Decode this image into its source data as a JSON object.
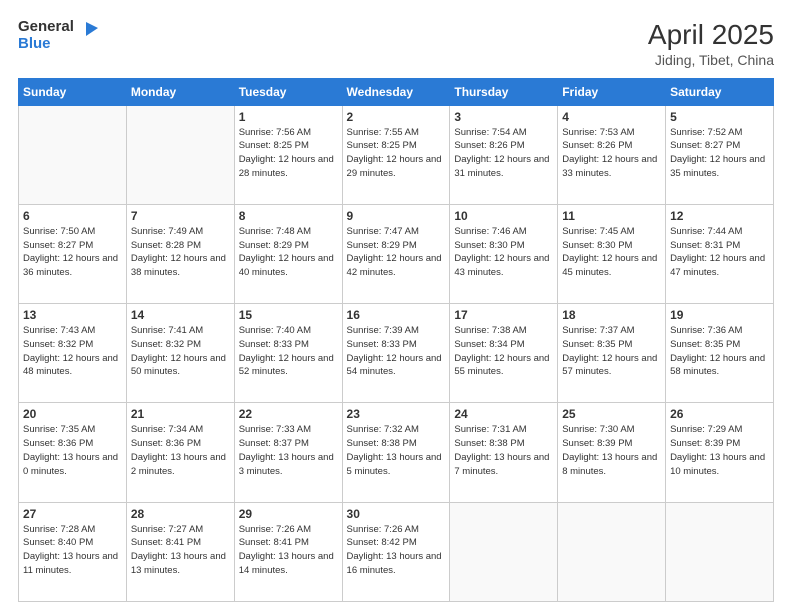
{
  "logo": {
    "general": "General",
    "blue": "Blue"
  },
  "title": "April 2025",
  "subtitle": "Jiding, Tibet, China",
  "days_header": [
    "Sunday",
    "Monday",
    "Tuesday",
    "Wednesday",
    "Thursday",
    "Friday",
    "Saturday"
  ],
  "weeks": [
    [
      {
        "day": "",
        "info": ""
      },
      {
        "day": "",
        "info": ""
      },
      {
        "day": "1",
        "info": "Sunrise: 7:56 AM\nSunset: 8:25 PM\nDaylight: 12 hours and 28 minutes."
      },
      {
        "day": "2",
        "info": "Sunrise: 7:55 AM\nSunset: 8:25 PM\nDaylight: 12 hours and 29 minutes."
      },
      {
        "day": "3",
        "info": "Sunrise: 7:54 AM\nSunset: 8:26 PM\nDaylight: 12 hours and 31 minutes."
      },
      {
        "day": "4",
        "info": "Sunrise: 7:53 AM\nSunset: 8:26 PM\nDaylight: 12 hours and 33 minutes."
      },
      {
        "day": "5",
        "info": "Sunrise: 7:52 AM\nSunset: 8:27 PM\nDaylight: 12 hours and 35 minutes."
      }
    ],
    [
      {
        "day": "6",
        "info": "Sunrise: 7:50 AM\nSunset: 8:27 PM\nDaylight: 12 hours and 36 minutes."
      },
      {
        "day": "7",
        "info": "Sunrise: 7:49 AM\nSunset: 8:28 PM\nDaylight: 12 hours and 38 minutes."
      },
      {
        "day": "8",
        "info": "Sunrise: 7:48 AM\nSunset: 8:29 PM\nDaylight: 12 hours and 40 minutes."
      },
      {
        "day": "9",
        "info": "Sunrise: 7:47 AM\nSunset: 8:29 PM\nDaylight: 12 hours and 42 minutes."
      },
      {
        "day": "10",
        "info": "Sunrise: 7:46 AM\nSunset: 8:30 PM\nDaylight: 12 hours and 43 minutes."
      },
      {
        "day": "11",
        "info": "Sunrise: 7:45 AM\nSunset: 8:30 PM\nDaylight: 12 hours and 45 minutes."
      },
      {
        "day": "12",
        "info": "Sunrise: 7:44 AM\nSunset: 8:31 PM\nDaylight: 12 hours and 47 minutes."
      }
    ],
    [
      {
        "day": "13",
        "info": "Sunrise: 7:43 AM\nSunset: 8:32 PM\nDaylight: 12 hours and 48 minutes."
      },
      {
        "day": "14",
        "info": "Sunrise: 7:41 AM\nSunset: 8:32 PM\nDaylight: 12 hours and 50 minutes."
      },
      {
        "day": "15",
        "info": "Sunrise: 7:40 AM\nSunset: 8:33 PM\nDaylight: 12 hours and 52 minutes."
      },
      {
        "day": "16",
        "info": "Sunrise: 7:39 AM\nSunset: 8:33 PM\nDaylight: 12 hours and 54 minutes."
      },
      {
        "day": "17",
        "info": "Sunrise: 7:38 AM\nSunset: 8:34 PM\nDaylight: 12 hours and 55 minutes."
      },
      {
        "day": "18",
        "info": "Sunrise: 7:37 AM\nSunset: 8:35 PM\nDaylight: 12 hours and 57 minutes."
      },
      {
        "day": "19",
        "info": "Sunrise: 7:36 AM\nSunset: 8:35 PM\nDaylight: 12 hours and 58 minutes."
      }
    ],
    [
      {
        "day": "20",
        "info": "Sunrise: 7:35 AM\nSunset: 8:36 PM\nDaylight: 13 hours and 0 minutes."
      },
      {
        "day": "21",
        "info": "Sunrise: 7:34 AM\nSunset: 8:36 PM\nDaylight: 13 hours and 2 minutes."
      },
      {
        "day": "22",
        "info": "Sunrise: 7:33 AM\nSunset: 8:37 PM\nDaylight: 13 hours and 3 minutes."
      },
      {
        "day": "23",
        "info": "Sunrise: 7:32 AM\nSunset: 8:38 PM\nDaylight: 13 hours and 5 minutes."
      },
      {
        "day": "24",
        "info": "Sunrise: 7:31 AM\nSunset: 8:38 PM\nDaylight: 13 hours and 7 minutes."
      },
      {
        "day": "25",
        "info": "Sunrise: 7:30 AM\nSunset: 8:39 PM\nDaylight: 13 hours and 8 minutes."
      },
      {
        "day": "26",
        "info": "Sunrise: 7:29 AM\nSunset: 8:39 PM\nDaylight: 13 hours and 10 minutes."
      }
    ],
    [
      {
        "day": "27",
        "info": "Sunrise: 7:28 AM\nSunset: 8:40 PM\nDaylight: 13 hours and 11 minutes."
      },
      {
        "day": "28",
        "info": "Sunrise: 7:27 AM\nSunset: 8:41 PM\nDaylight: 13 hours and 13 minutes."
      },
      {
        "day": "29",
        "info": "Sunrise: 7:26 AM\nSunset: 8:41 PM\nDaylight: 13 hours and 14 minutes."
      },
      {
        "day": "30",
        "info": "Sunrise: 7:26 AM\nSunset: 8:42 PM\nDaylight: 13 hours and 16 minutes."
      },
      {
        "day": "",
        "info": ""
      },
      {
        "day": "",
        "info": ""
      },
      {
        "day": "",
        "info": ""
      }
    ]
  ]
}
